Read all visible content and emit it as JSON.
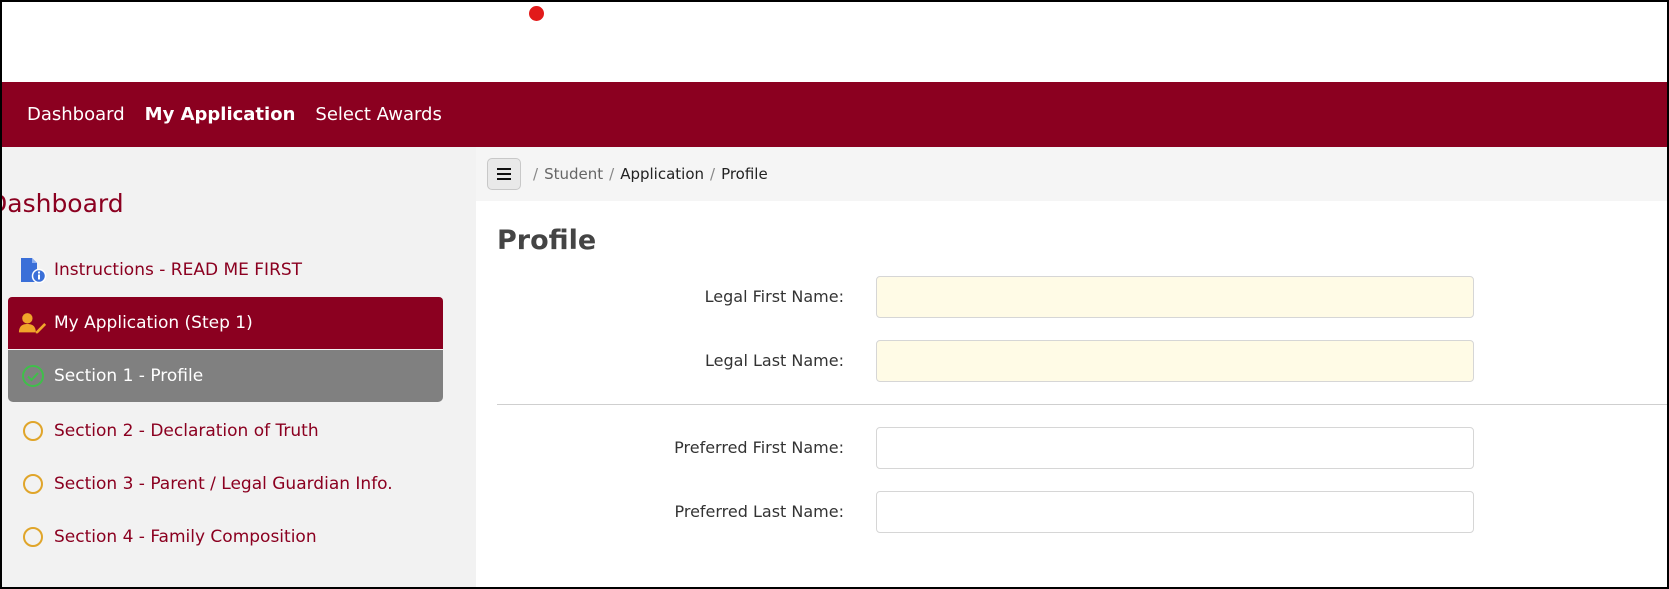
{
  "colors": {
    "brand": "#8b0020",
    "accent_circle": "#e0a52a",
    "check": "#3fbf4a"
  },
  "navbar": {
    "items": [
      {
        "label": "Dashboard",
        "active": false
      },
      {
        "label": "My Application",
        "active": true
      },
      {
        "label": "Select Awards",
        "active": false
      }
    ]
  },
  "sidebar": {
    "title": "Dashboard",
    "items": [
      {
        "label": "Instructions - READ ME FIRST",
        "icon": "document-info-icon"
      },
      {
        "label": "My Application (Step 1)",
        "icon": "user-edit-icon"
      },
      {
        "label": "Section 1 - Profile",
        "icon": "check-circle-icon"
      },
      {
        "label": "Section 2 - Declaration of Truth",
        "icon": "circle-icon"
      },
      {
        "label": "Section 3 - Parent / Legal Guardian Info.",
        "icon": "circle-icon"
      },
      {
        "label": "Section 4 - Family Composition",
        "icon": "circle-icon"
      }
    ]
  },
  "breadcrumb": {
    "items": [
      "Student",
      "Application",
      "Profile"
    ]
  },
  "main": {
    "title": "Profile",
    "fields": [
      {
        "label": "Legal First Name:",
        "value": ""
      },
      {
        "label": "Legal Last Name:",
        "value": ""
      },
      {
        "label": "Preferred First Name:",
        "value": ""
      },
      {
        "label": "Preferred Last Name:",
        "value": ""
      }
    ]
  }
}
